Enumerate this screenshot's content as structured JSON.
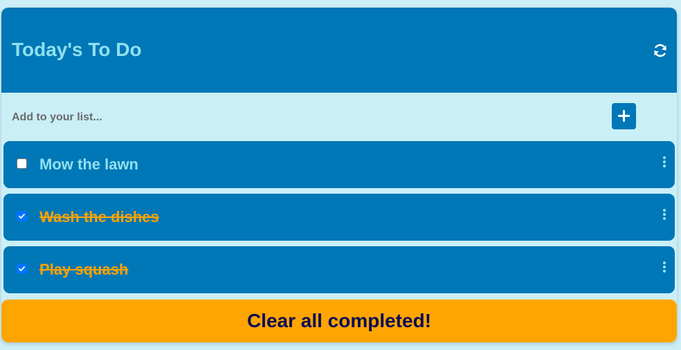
{
  "header": {
    "title": "Today's To Do",
    "refresh_icon": "refresh-icon"
  },
  "add": {
    "placeholder": "Add to your list...",
    "button_icon": "plus-icon"
  },
  "items": [
    {
      "label": "Mow the lawn",
      "completed": false,
      "menu_icon": "kebab-menu-icon"
    },
    {
      "label": "Wash the dishes",
      "completed": true,
      "menu_icon": "kebab-menu-icon"
    },
    {
      "label": "Play squash",
      "completed": true,
      "menu_icon": "kebab-menu-icon"
    }
  ],
  "footer": {
    "clear_label": "Clear all completed!"
  },
  "colors": {
    "header_bg": "#0077b6",
    "title_text": "#90e0ef",
    "panel_bg": "#caeff7",
    "completed_text": "#ffa200",
    "clear_button_bg": "#ffa500",
    "clear_button_text": "#0b0b55"
  }
}
